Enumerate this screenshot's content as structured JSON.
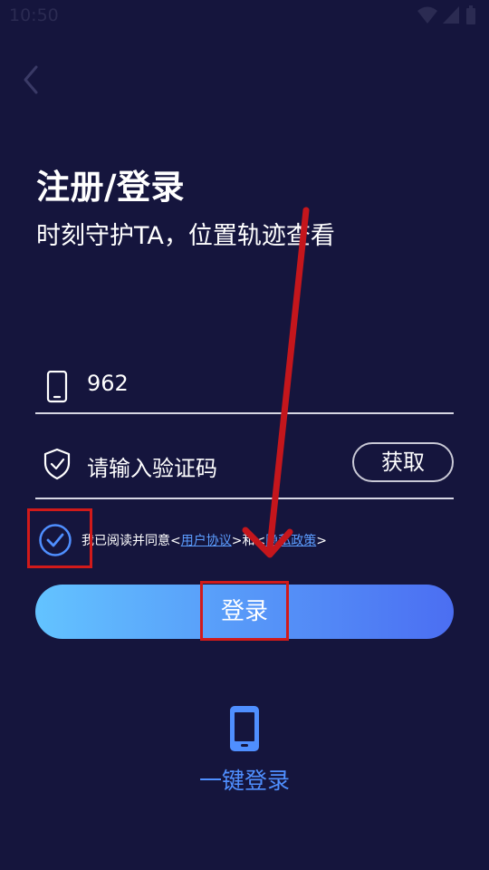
{
  "status_bar": {
    "time": "10:50"
  },
  "header": {
    "title": "注册/登录",
    "subtitle": "时刻守护TA，位置轨迹查看"
  },
  "form": {
    "phone_value": "962",
    "code_placeholder": "请输入验证码",
    "get_code_label": "获取"
  },
  "agreement": {
    "prefix": "我已阅读并同意<",
    "user_agreement": "用户协议",
    "middle": ">和<",
    "privacy_policy": "隐私政策",
    "suffix": ">",
    "checked": true
  },
  "login_button_label": "登录",
  "one_key_login_label": "一键登录",
  "colors": {
    "background": "#15153d",
    "accent": "#4f8fff",
    "gradient_start": "#63c3ff",
    "gradient_end": "#4b6ef2",
    "annotation": "#d11a1a"
  },
  "icons": [
    "back-arrow-icon",
    "wifi-icon",
    "signal-icon",
    "battery-icon",
    "phone-icon",
    "shield-check-icon",
    "check-circle-icon",
    "mobile-icon"
  ]
}
